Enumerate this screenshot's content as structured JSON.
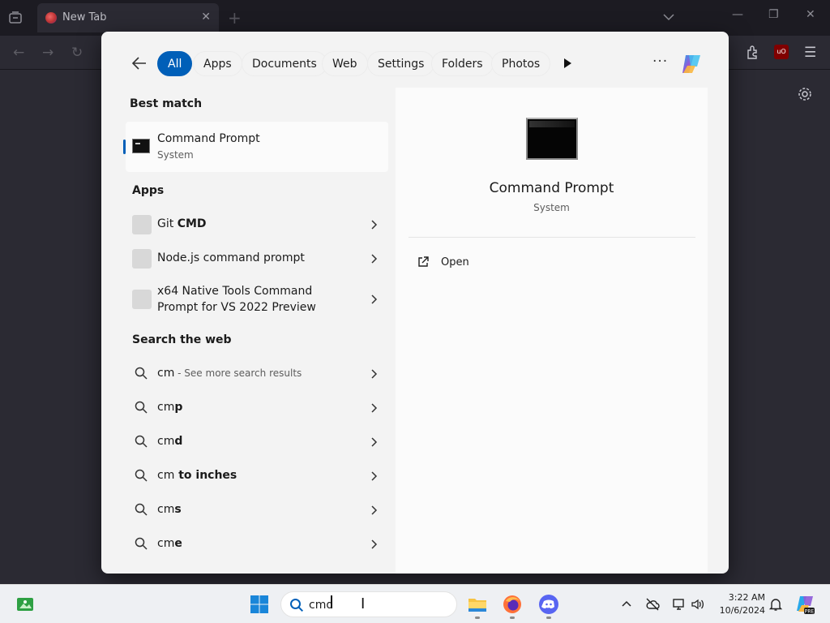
{
  "browser": {
    "tab_title": "New Tab",
    "tab_close": "✕",
    "new_tab": "+",
    "window_controls": {
      "minimize": "—",
      "restore": "❐",
      "close": "✕"
    },
    "nav": {
      "back": "←",
      "forward": "→",
      "reload": "↻",
      "menu": "☰"
    }
  },
  "search_flyout": {
    "filters": [
      "All",
      "Apps",
      "Documents",
      "Web",
      "Settings",
      "Folders",
      "Photos"
    ],
    "active_filter": "All",
    "more_label": "···",
    "best_match": {
      "heading": "Best match",
      "title": "Command Prompt",
      "subtitle": "System"
    },
    "apps": {
      "heading": "Apps",
      "items": [
        {
          "prefix": "Git ",
          "bold": "CMD"
        },
        {
          "label": "Node.js command prompt"
        },
        {
          "line1": "x64 Native Tools Command",
          "line2": "Prompt for VS 2022 Preview"
        }
      ]
    },
    "web": {
      "heading": "Search the web",
      "items": [
        {
          "query": "cm",
          "suffix": " - See more search results"
        },
        {
          "query": "cm",
          "bold": "p"
        },
        {
          "query": "cm",
          "bold": "d"
        },
        {
          "query": "cm",
          "bold": " to inches"
        },
        {
          "query": "cm",
          "bold": "s"
        },
        {
          "query": "cm",
          "bold": "e"
        }
      ]
    },
    "details": {
      "title": "Command Prompt",
      "subtitle": "System",
      "actions": [
        {
          "label": "Open",
          "icon": "open-external-icon"
        }
      ]
    }
  },
  "taskbar": {
    "search_value": "cmd",
    "clock_time": "3:22 AM",
    "clock_date": "10/6/2024",
    "accent": "#005fb8"
  }
}
